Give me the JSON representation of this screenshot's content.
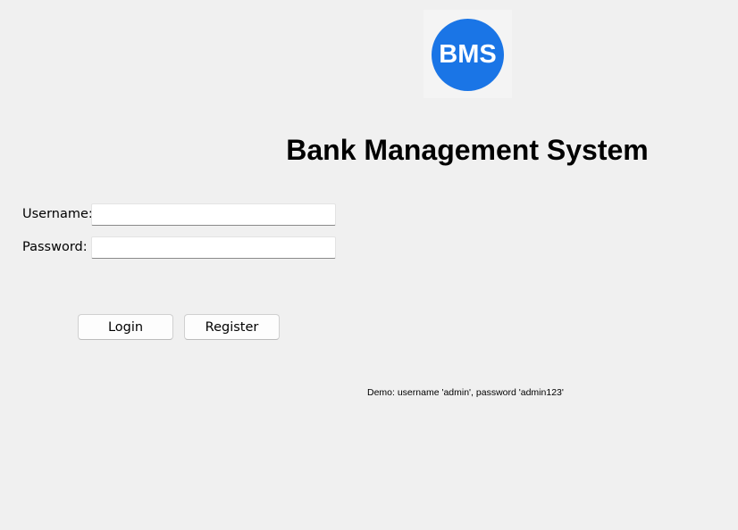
{
  "logo": {
    "text": "BMS",
    "color": "#1a75e6"
  },
  "header": {
    "title": "Bank Management System"
  },
  "form": {
    "username_label": "Username:",
    "username_value": "",
    "password_label": "Password:",
    "password_value": ""
  },
  "actions": {
    "login_label": "Login",
    "register_label": "Register"
  },
  "footer": {
    "demo_hint": "Demo: username 'admin', password 'admin123'"
  }
}
